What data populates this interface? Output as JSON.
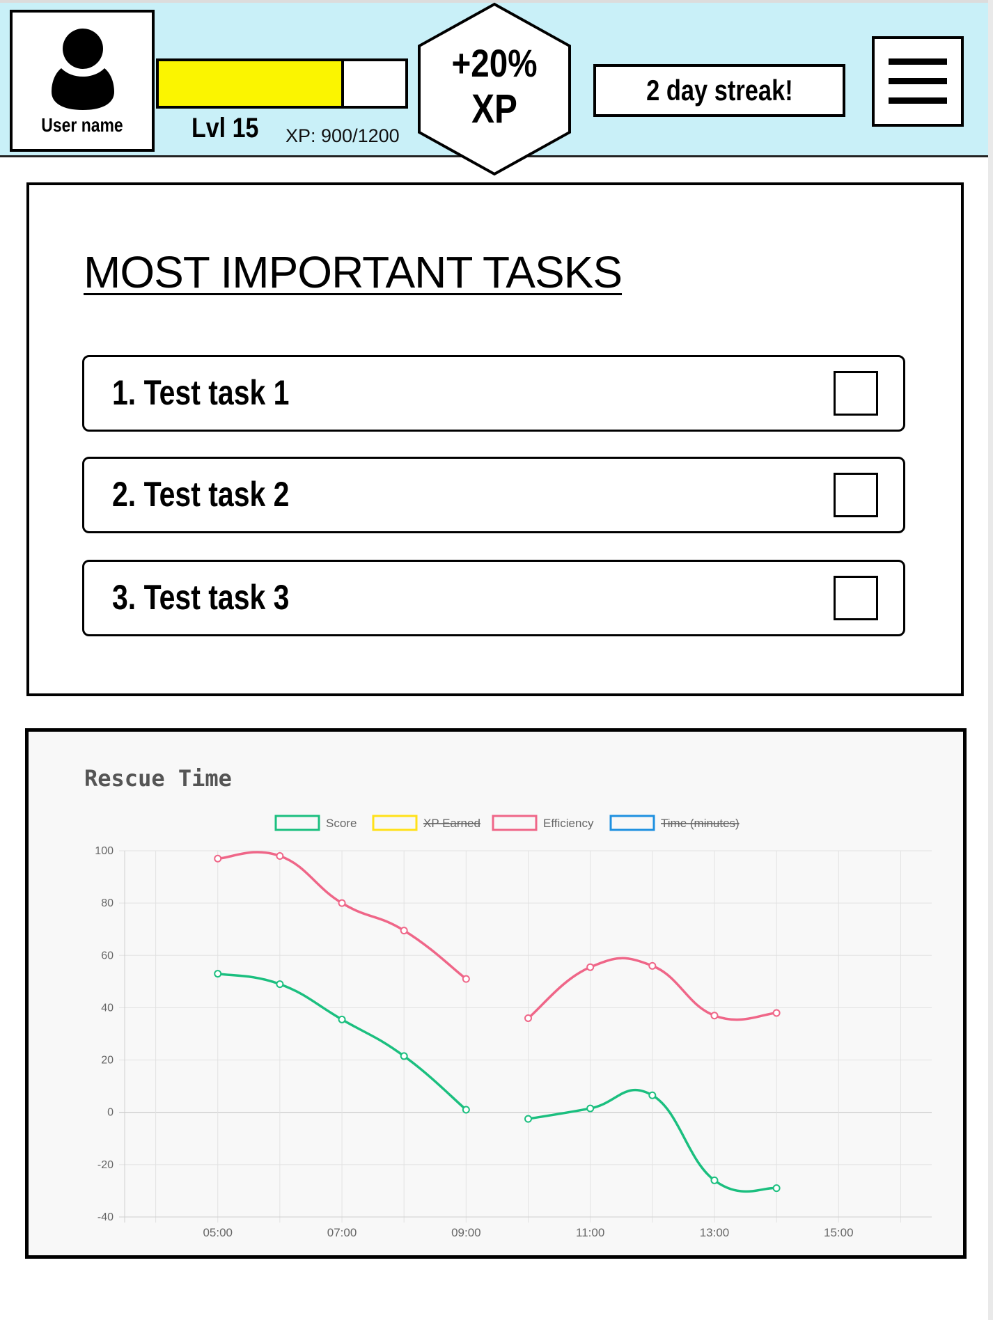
{
  "header": {
    "user_name": "User name",
    "level": "Lvl 15",
    "xp_text": "XP: 900/1200",
    "xp_progress": 0.75,
    "bonus_value": "+20%",
    "bonus_unit": "XP",
    "streak": "2 day streak!",
    "icons": {
      "avatar": "user-avatar-icon",
      "menu": "hamburger-menu-icon"
    },
    "colors": {
      "background": "#c9f0f8",
      "xp_fill": "#fbf500"
    }
  },
  "tasks": {
    "title": "MOST IMPORTANT TASKS",
    "items": [
      {
        "label": "1. Test task 1",
        "checked": false
      },
      {
        "label": "2. Test task 2",
        "checked": false
      },
      {
        "label": "3. Test task 3",
        "checked": false
      }
    ]
  },
  "chart_data": {
    "type": "line",
    "title": "Rescue Time",
    "xlabel": "",
    "ylabel": "",
    "x_ticks": [
      "05:00",
      "07:00",
      "09:00",
      "11:00",
      "13:00",
      "15:00"
    ],
    "y_ticks": [
      "100",
      "80",
      "60",
      "40",
      "20",
      "0",
      "-20",
      "-40"
    ],
    "ylim": [
      -40,
      100
    ],
    "xlim": [
      "03:30",
      "16:30"
    ],
    "grid": true,
    "legend_position": "top",
    "legend": [
      {
        "name": "Score",
        "color": "#1bbf7f",
        "hidden": false
      },
      {
        "name": "XP Earned",
        "color": "#ffe119",
        "hidden": true
      },
      {
        "name": "Efficiency",
        "color": "#ef6688",
        "hidden": false
      },
      {
        "name": "Time (minutes)",
        "color": "#1e90e0",
        "hidden": true
      }
    ],
    "series": [
      {
        "name": "Score",
        "color": "#1bbf7f",
        "segments": [
          [
            [
              "05:00",
              53
            ],
            [
              "06:00",
              49
            ],
            [
              "07:00",
              35.5
            ],
            [
              "08:00",
              21.5
            ],
            [
              "09:00",
              1
            ]
          ],
          [
            [
              "10:00",
              -2.5
            ],
            [
              "11:00",
              1.5
            ],
            [
              "12:00",
              6.5
            ],
            [
              "13:00",
              -26
            ],
            [
              "14:00",
              -29
            ]
          ]
        ]
      },
      {
        "name": "Efficiency",
        "color": "#ef6688",
        "segments": [
          [
            [
              "05:00",
              97
            ],
            [
              "06:00",
              98
            ],
            [
              "07:00",
              80
            ],
            [
              "08:00",
              69.5
            ],
            [
              "09:00",
              51
            ]
          ],
          [
            [
              "10:00",
              36
            ],
            [
              "11:00",
              55.5
            ],
            [
              "12:00",
              56
            ],
            [
              "13:00",
              37
            ],
            [
              "14:00",
              38
            ]
          ]
        ]
      }
    ]
  }
}
